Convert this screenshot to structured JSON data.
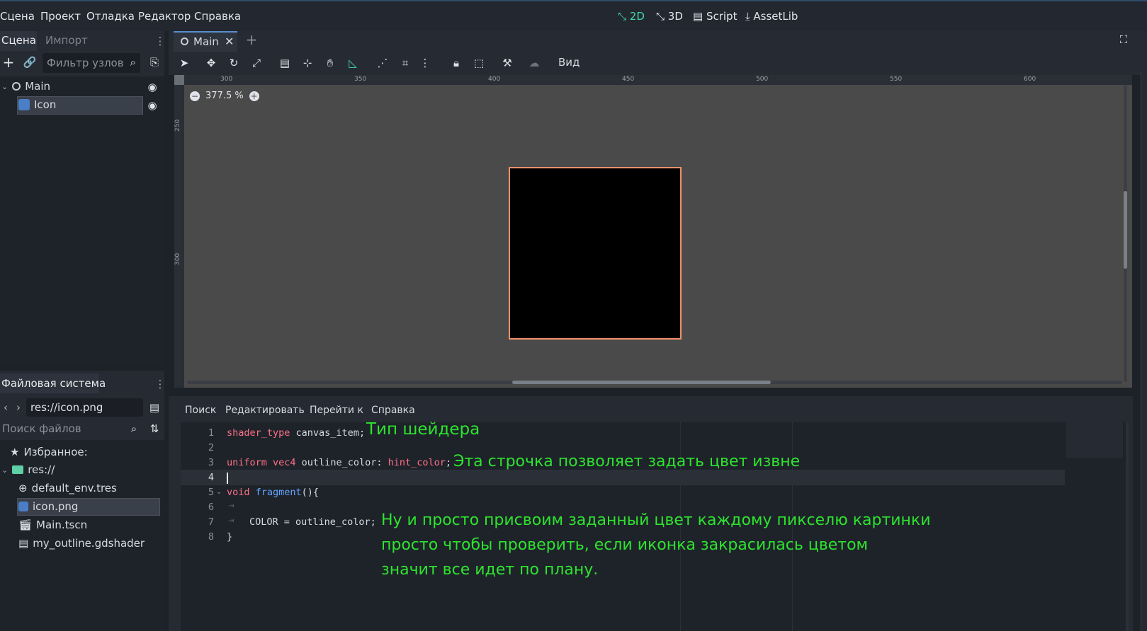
{
  "menu": [
    "Сцена",
    "Проект",
    "Отладка",
    "Редактор",
    "Справка"
  ],
  "modes": {
    "m2d": "2D",
    "m3d": "3D",
    "script": "Script",
    "assetlib": "AssetLib"
  },
  "scene_dock": {
    "tabs": {
      "scene": "Сцена",
      "import": "Импорт"
    },
    "filter_placeholder": "Фильтр узлов",
    "nodes": {
      "main": "Main",
      "icon": "Icon"
    }
  },
  "filesystem": {
    "title": "Файловая система",
    "path": "res://icon.png",
    "search_placeholder": "Поиск файлов",
    "favorites": "Избранное:",
    "root": "res://",
    "files": [
      "default_env.tres",
      "icon.png",
      "Main.tscn",
      "my_outline.gdshader"
    ]
  },
  "editor_tab": {
    "name": "Main"
  },
  "toolbar": {
    "view": "Вид"
  },
  "viewport": {
    "zoom": "377.5 %",
    "ruler_x": [
      "300",
      "350",
      "400",
      "450",
      "500",
      "550",
      "600"
    ],
    "ruler_y": [
      "250",
      "300"
    ]
  },
  "script_menu": {
    "search": "Поиск",
    "edit": "Редактировать",
    "goto": "Перейти к",
    "help": "Справка"
  },
  "code": {
    "line_numbers": [
      "1",
      "2",
      "3",
      "4",
      "5",
      "6",
      "7",
      "8"
    ],
    "l1_kw": "shader_type",
    "l1_rest": " canvas_item;",
    "l3_kw": "uniform vec4",
    "l3_mid": " outline_color: ",
    "l3_hint": "hint_color",
    "l3_end": ";",
    "l5_kw": "void",
    "l5_fn": " fragment",
    "l5_rest": "(){",
    "l7": "COLOR = outline_color;",
    "l8": "}"
  },
  "annotations": {
    "a1": "Тип шейдера",
    "a2": "Эта строчка позволяет задать цвет извне",
    "a3_line1": "Ну и просто присвоим заданный цвет каждому пикселю картинки",
    "a3_line2": "просто чтобы проверить, если иконка закрасилась цветом",
    "a3_line3": "значит все идет по плану."
  },
  "colors": {
    "accent": "#45d6a8",
    "annotation": "#2ee32e",
    "keyword": "#ff7085",
    "function": "#66a6ff",
    "outline": "#f0906a"
  }
}
